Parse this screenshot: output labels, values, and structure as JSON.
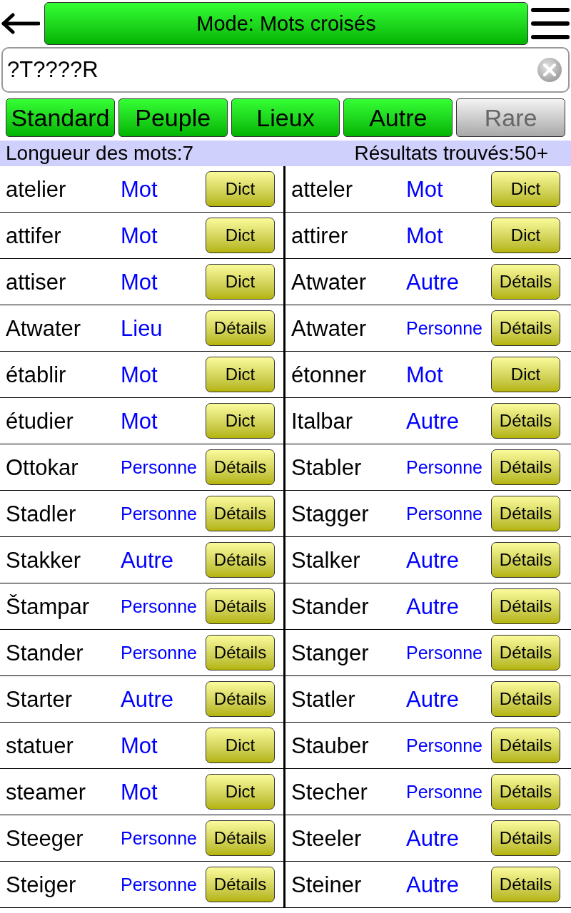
{
  "header": {
    "title": "Mode: Mots croisés"
  },
  "search": {
    "value": "?T????R"
  },
  "filters": [
    {
      "label": "Standard",
      "selected": true
    },
    {
      "label": "Peuple",
      "selected": true
    },
    {
      "label": "Lieux",
      "selected": true
    },
    {
      "label": "Autre",
      "selected": true
    },
    {
      "label": "Rare",
      "selected": false
    }
  ],
  "info": {
    "word_length": "Longueur des mots:7",
    "results_found": "Résultats trouvés:50+"
  },
  "results": [
    {
      "word": "atelier",
      "type": "Mot",
      "kind": "word",
      "action": "Dict"
    },
    {
      "word": "atteler",
      "type": "Mot",
      "kind": "word",
      "action": "Dict"
    },
    {
      "word": "attifer",
      "type": "Mot",
      "kind": "word",
      "action": "Dict"
    },
    {
      "word": "attirer",
      "type": "Mot",
      "kind": "word",
      "action": "Dict"
    },
    {
      "word": "attiser",
      "type": "Mot",
      "kind": "word",
      "action": "Dict"
    },
    {
      "word": "Atwater",
      "type": "Autre",
      "kind": "other",
      "action": "Détails"
    },
    {
      "word": "Atwater",
      "type": "Lieu",
      "kind": "place",
      "action": "Détails"
    },
    {
      "word": "Atwater",
      "type": "Personne",
      "kind": "person",
      "action": "Détails"
    },
    {
      "word": "établir",
      "type": "Mot",
      "kind": "word",
      "action": "Dict"
    },
    {
      "word": "étonner",
      "type": "Mot",
      "kind": "word",
      "action": "Dict"
    },
    {
      "word": "étudier",
      "type": "Mot",
      "kind": "word",
      "action": "Dict"
    },
    {
      "word": "Italbar",
      "type": "Autre",
      "kind": "other",
      "action": "Détails"
    },
    {
      "word": "Ottokar",
      "type": "Personne",
      "kind": "person",
      "action": "Détails"
    },
    {
      "word": "Stabler",
      "type": "Personne",
      "kind": "person",
      "action": "Détails"
    },
    {
      "word": "Stadler",
      "type": "Personne",
      "kind": "person",
      "action": "Détails"
    },
    {
      "word": "Stagger",
      "type": "Personne",
      "kind": "person",
      "action": "Détails"
    },
    {
      "word": "Stakker",
      "type": "Autre",
      "kind": "other",
      "action": "Détails"
    },
    {
      "word": "Stalker",
      "type": "Autre",
      "kind": "other",
      "action": "Détails"
    },
    {
      "word": "Štampar",
      "type": "Personne",
      "kind": "person",
      "action": "Détails"
    },
    {
      "word": "Stander",
      "type": "Autre",
      "kind": "other",
      "action": "Détails"
    },
    {
      "word": "Stander",
      "type": "Personne",
      "kind": "person",
      "action": "Détails"
    },
    {
      "word": "Stanger",
      "type": "Personne",
      "kind": "person",
      "action": "Détails"
    },
    {
      "word": "Starter",
      "type": "Autre",
      "kind": "other",
      "action": "Détails"
    },
    {
      "word": "Statler",
      "type": "Autre",
      "kind": "other",
      "action": "Détails"
    },
    {
      "word": "statuer",
      "type": "Mot",
      "kind": "word",
      "action": "Dict"
    },
    {
      "word": "Stauber",
      "type": "Personne",
      "kind": "person",
      "action": "Détails"
    },
    {
      "word": "steamer",
      "type": "Mot",
      "kind": "word",
      "action": "Dict"
    },
    {
      "word": "Stecher",
      "type": "Personne",
      "kind": "person",
      "action": "Détails"
    },
    {
      "word": "Steeger",
      "type": "Personne",
      "kind": "person",
      "action": "Détails"
    },
    {
      "word": "Steeler",
      "type": "Autre",
      "kind": "other",
      "action": "Détails"
    },
    {
      "word": "Steiger",
      "type": "Personne",
      "kind": "person",
      "action": "Détails"
    },
    {
      "word": "Steiner",
      "type": "Autre",
      "kind": "other",
      "action": "Détails"
    }
  ]
}
